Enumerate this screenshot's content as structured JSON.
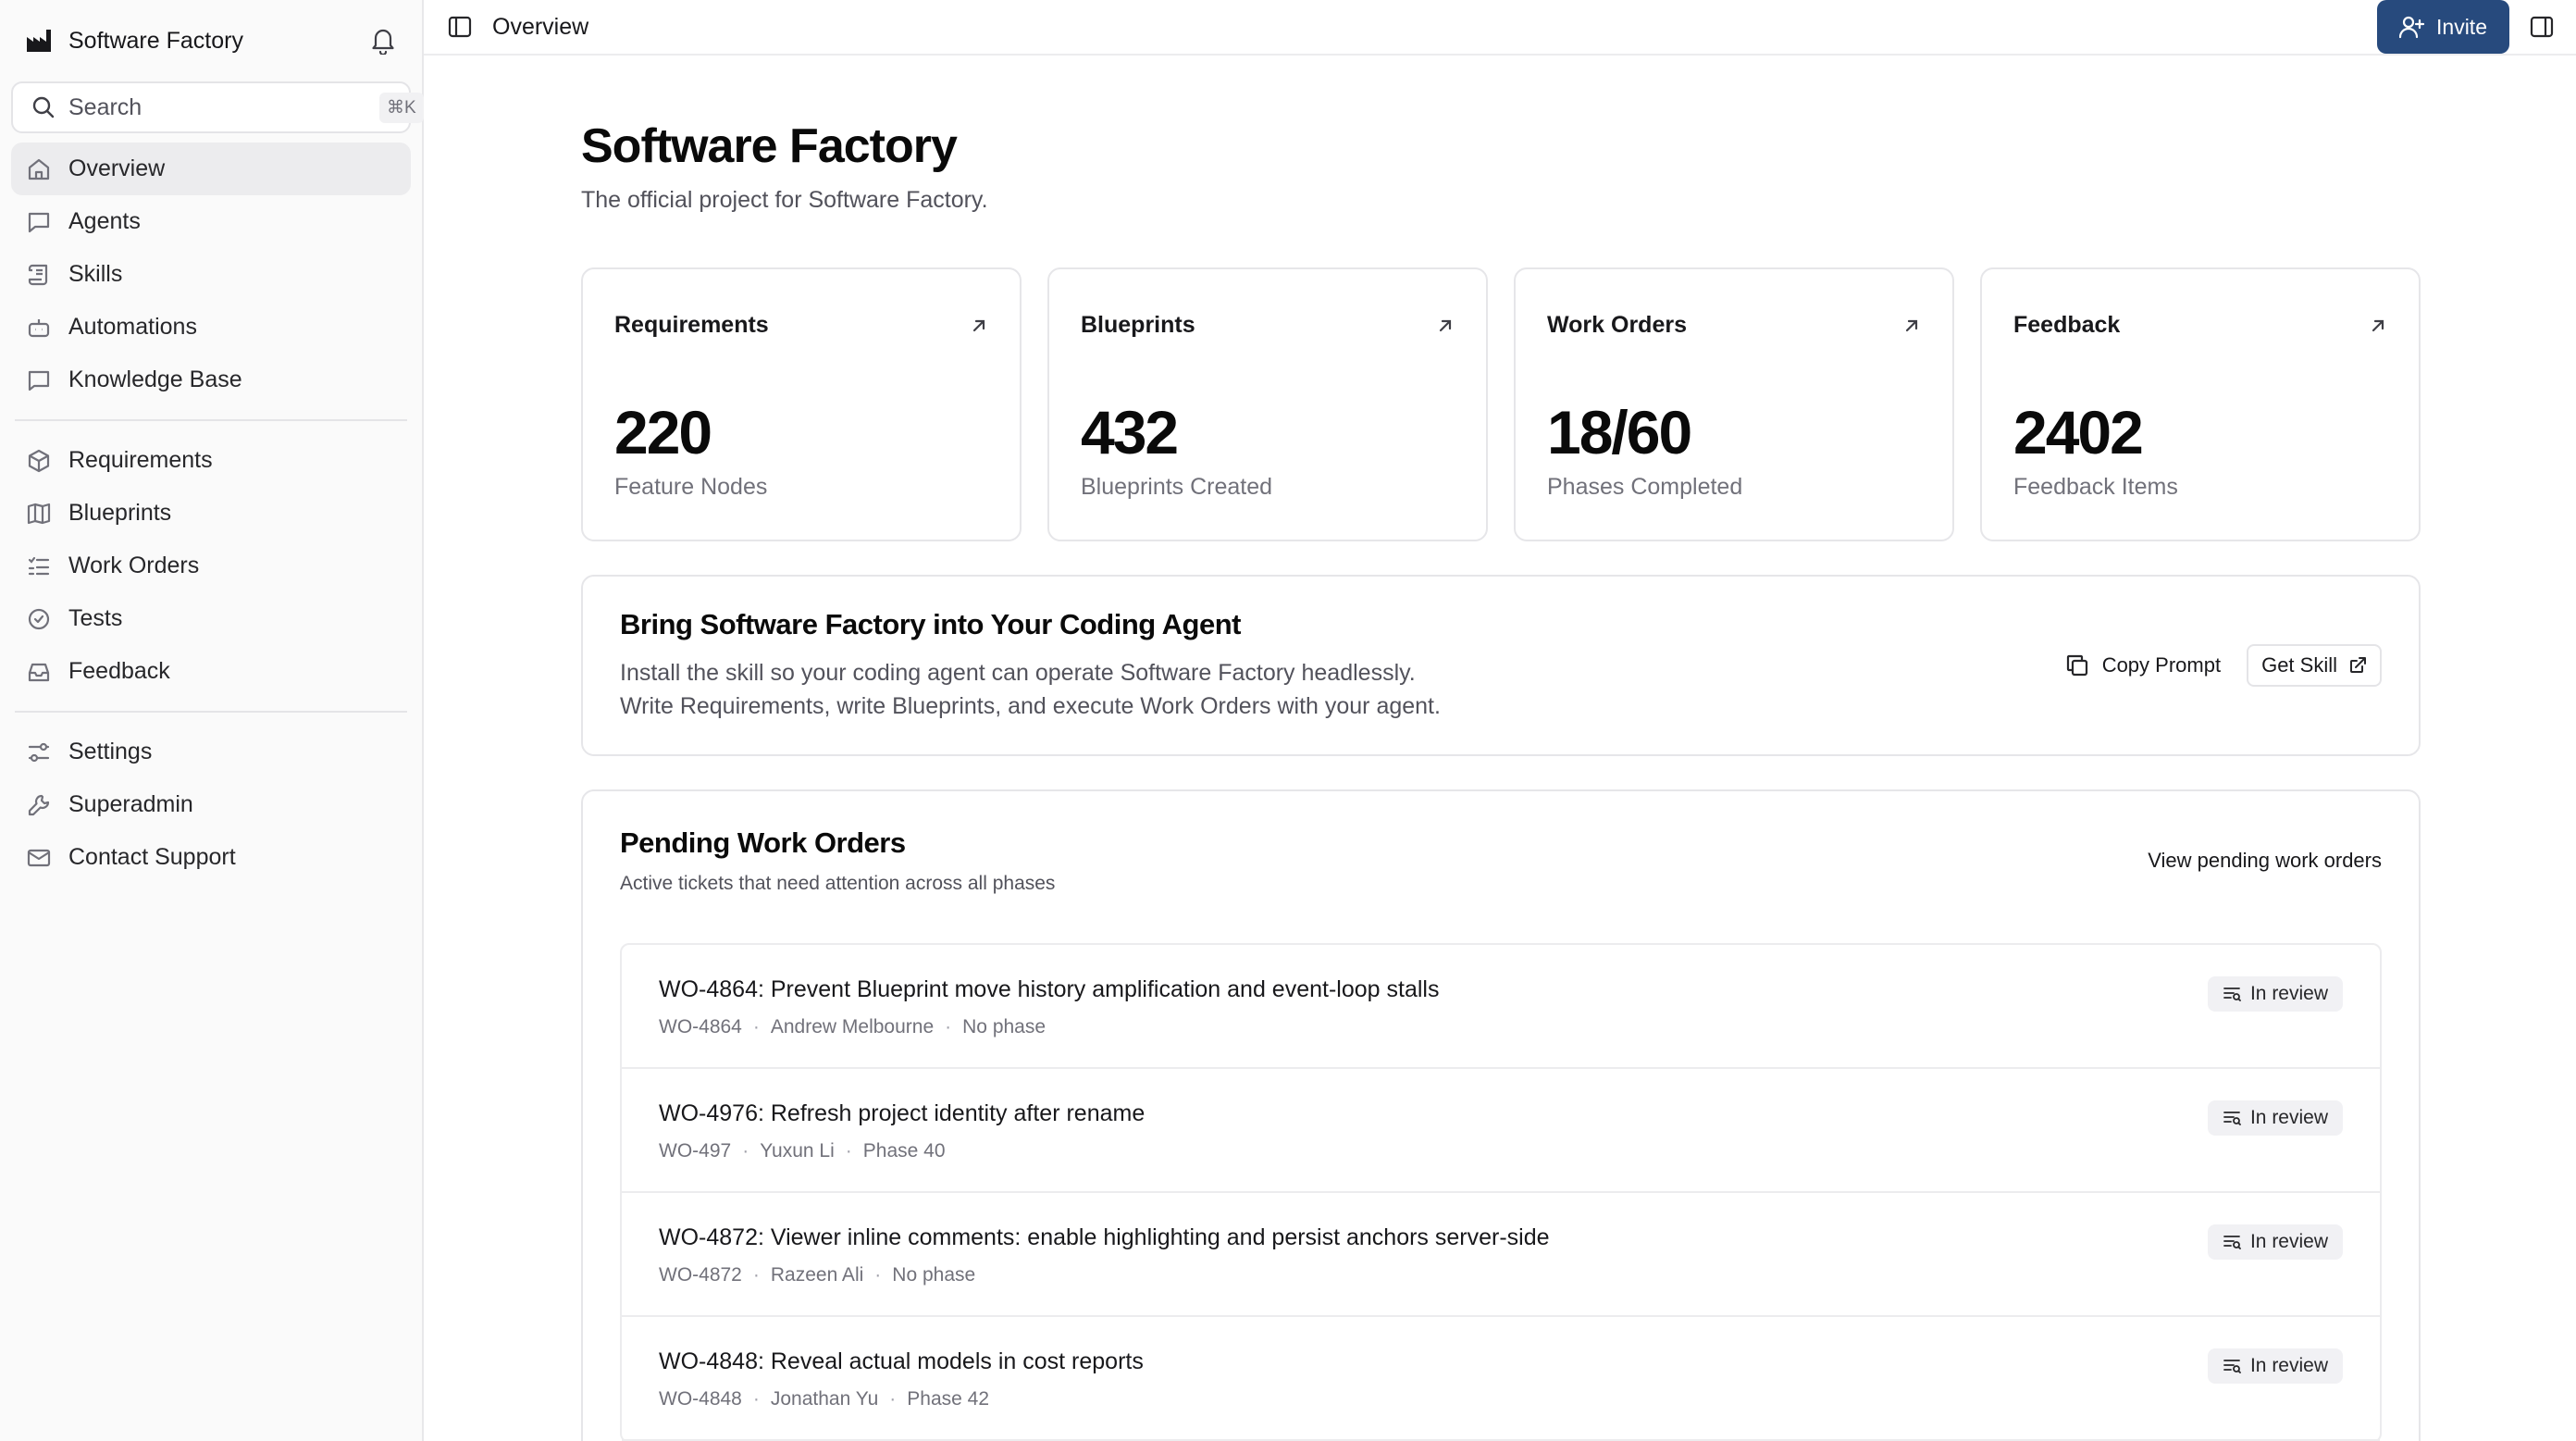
{
  "sidebar": {
    "brand": "Software Factory",
    "search_placeholder": "Search",
    "search_shortcut": "⌘K",
    "nav_primary": [
      {
        "label": "Overview",
        "icon": "home-icon",
        "active": true
      },
      {
        "label": "Agents",
        "icon": "chat-icon"
      },
      {
        "label": "Skills",
        "icon": "scroll-icon"
      },
      {
        "label": "Automations",
        "icon": "bot-icon"
      },
      {
        "label": "Knowledge Base",
        "icon": "chat-square-icon"
      }
    ],
    "nav_project": [
      {
        "label": "Requirements",
        "icon": "cube-icon"
      },
      {
        "label": "Blueprints",
        "icon": "map-icon"
      },
      {
        "label": "Work Orders",
        "icon": "list-check-icon"
      },
      {
        "label": "Tests",
        "icon": "check-circle-icon"
      },
      {
        "label": "Feedback",
        "icon": "inbox-icon"
      }
    ],
    "nav_system": [
      {
        "label": "Settings",
        "icon": "sliders-icon"
      },
      {
        "label": "Superadmin",
        "icon": "wrench-icon"
      },
      {
        "label": "Contact Support",
        "icon": "mail-icon"
      }
    ]
  },
  "topbar": {
    "title": "Overview",
    "invite_label": "Invite"
  },
  "page": {
    "title": "Software Factory",
    "subtitle": "The official project for Software Factory."
  },
  "stats": [
    {
      "label": "Requirements",
      "value": "220",
      "caption": "Feature Nodes"
    },
    {
      "label": "Blueprints",
      "value": "432",
      "caption": "Blueprints Created"
    },
    {
      "label": "Work Orders",
      "value": "18/60",
      "caption": "Phases Completed"
    },
    {
      "label": "Feedback",
      "value": "2402",
      "caption": "Feedback Items"
    }
  ],
  "skill": {
    "title": "Bring Software Factory into Your Coding Agent",
    "desc_line1": "Install the skill so your coding agent can operate Software Factory headlessly.",
    "desc_line2": "Write Requirements, write Blueprints, and execute Work Orders with your agent.",
    "copy_label": "Copy Prompt",
    "get_label": "Get Skill"
  },
  "pending": {
    "title": "Pending Work Orders",
    "subtitle": "Active tickets that need attention across all phases",
    "view_link": "View pending work orders",
    "items": [
      {
        "title": "WO-4864: Prevent Blueprint move history amplification and event-loop stalls",
        "id": "WO-4864",
        "owner": "Andrew Melbourne",
        "phase": "No phase",
        "status": "In review"
      },
      {
        "title": "WO-4976: Refresh project identity after rename",
        "id": "WO-497",
        "owner": "Yuxun Li",
        "phase": "Phase 40",
        "status": "In review"
      },
      {
        "title": "WO-4872: Viewer inline comments: enable highlighting and persist anchors server-side",
        "id": "WO-4872",
        "owner": "Razeen Ali",
        "phase": "No phase",
        "status": "In review"
      },
      {
        "title": "WO-4848: Reveal actual models in cost reports",
        "id": "WO-4848",
        "owner": "Jonathan Yu",
        "phase": "Phase 42",
        "status": "In review"
      }
    ]
  },
  "colors": {
    "accent": "#274a7d",
    "sidebar_bg": "#fafafa",
    "border": "#e6e6e9"
  }
}
